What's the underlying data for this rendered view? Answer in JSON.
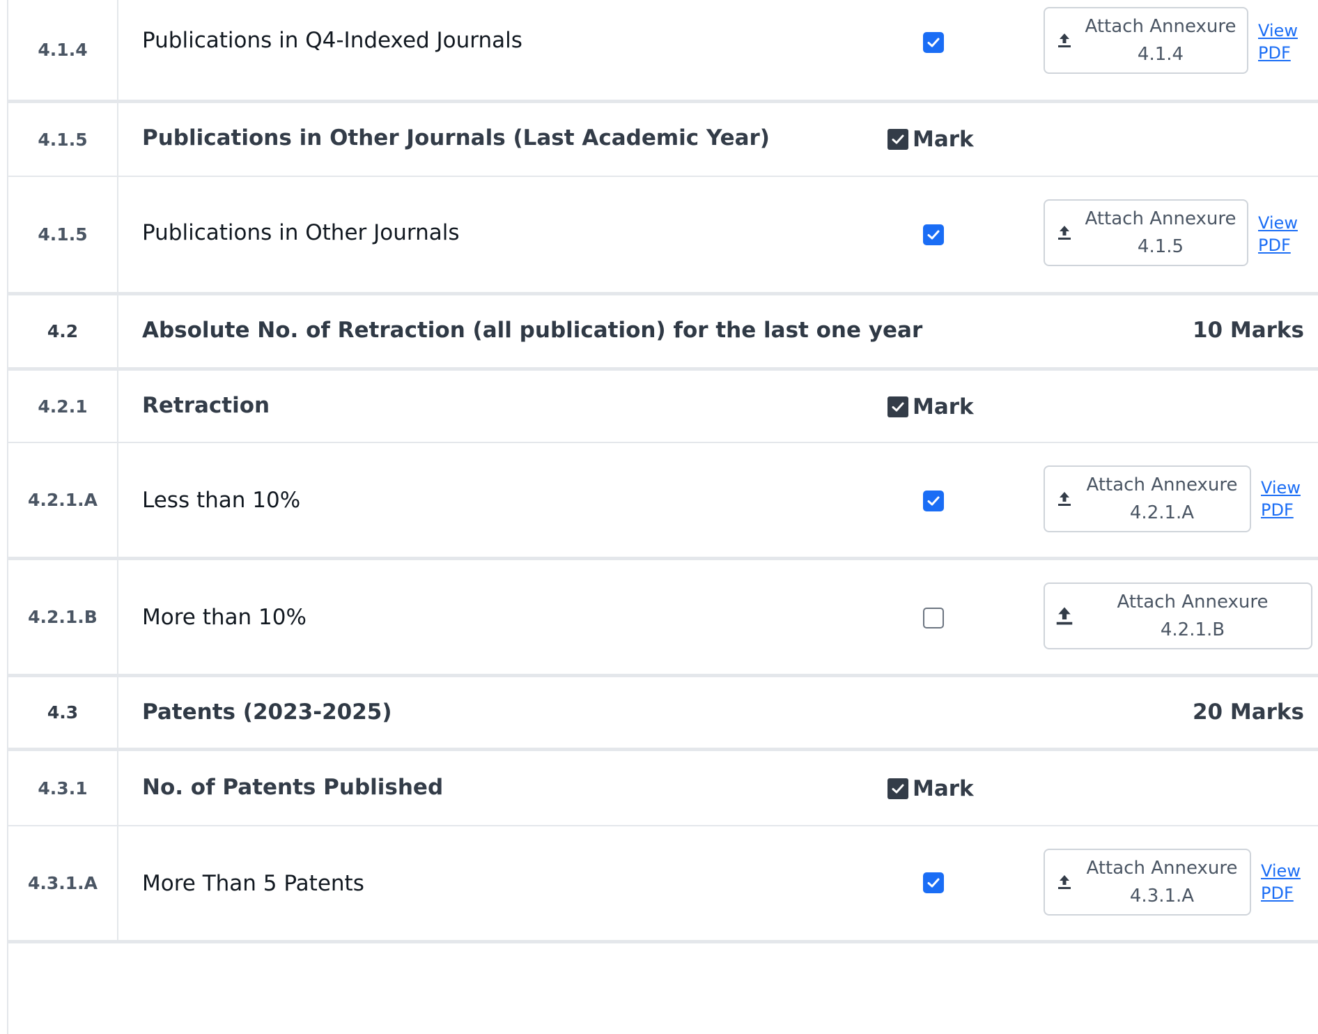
{
  "rows": [
    {
      "code": "4.1.4",
      "title": "Publications in Q4-Indexed Journals",
      "attach": "Attach Annexure 4.1.4",
      "view": "View PDF"
    },
    {
      "code": "4.1.5",
      "title": "Publications in Other Journals (Last Academic Year)",
      "mark": "Mark"
    },
    {
      "code": "4.1.5",
      "title": "Publications in Other Journals",
      "attach": "Attach Annexure 4.1.5",
      "view": "View PDF"
    },
    {
      "code": "4.2",
      "title": "Absolute No. of Retraction (all publication) for the last one year",
      "marks": "10 Marks"
    },
    {
      "code": "4.2.1",
      "title": "Retraction",
      "mark": "Mark"
    },
    {
      "code": "4.2.1.A",
      "title": "Less than 10%",
      "attach": "Attach Annexure 4.2.1.A",
      "view": "View PDF"
    },
    {
      "code": "4.2.1.B",
      "title": "More than 10%",
      "attach": "Attach Annexure 4.2.1.B"
    },
    {
      "code": "4.3",
      "title": "Patents (2023-2025)",
      "marks": "20 Marks"
    },
    {
      "code": "4.3.1",
      "title": "No. of Patents Published",
      "mark": "Mark"
    },
    {
      "code": "4.3.1.A",
      "title": "More Than 5 Patents",
      "attach": "Attach Annexure 4.3.1.A",
      "view": "View PDF"
    }
  ],
  "checkboxes": {
    "row_4_1_4": true,
    "row_4_1_5": true,
    "row_4_2_1_A": true,
    "row_4_2_1_B": false,
    "row_4_3_1_A": true
  },
  "colors": {
    "accent": "#1a6df5",
    "heading": "#333c48",
    "border": "#e4e7eb"
  }
}
